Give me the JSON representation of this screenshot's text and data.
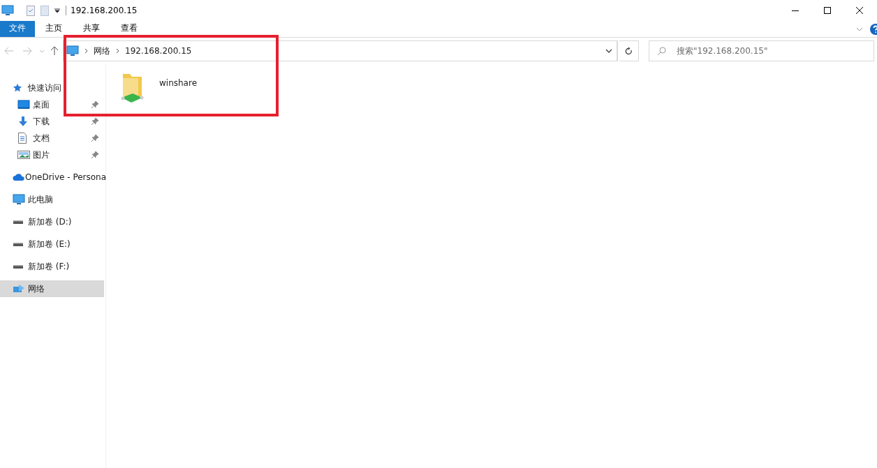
{
  "window": {
    "title": "192.168.200.15"
  },
  "ribbon": {
    "tabs": [
      {
        "label": "文件",
        "kind": "file"
      },
      {
        "label": "主页",
        "kind": "tab"
      },
      {
        "label": "共享",
        "kind": "tab"
      },
      {
        "label": "查看",
        "kind": "tab"
      }
    ]
  },
  "address_bar": {
    "crumbs": [
      "网络",
      "192.168.200.15"
    ]
  },
  "search": {
    "placeholder": "搜索\"192.168.200.15\""
  },
  "sidebar": {
    "items": [
      {
        "label": "快速访问",
        "kind": "star",
        "selected": false,
        "children": [
          {
            "label": "桌面",
            "kind": "desktop",
            "pinned": true,
            "selected": false
          },
          {
            "label": "下载",
            "kind": "download",
            "pinned": true,
            "selected": false
          },
          {
            "label": "文档",
            "kind": "document",
            "pinned": true,
            "selected": false
          },
          {
            "label": "图片",
            "kind": "image",
            "pinned": true,
            "selected": false
          }
        ]
      },
      {
        "label": "OneDrive - Persona",
        "kind": "cloud",
        "selected": false
      },
      {
        "label": "此电脑",
        "kind": "pc",
        "selected": false
      },
      {
        "label": "新加卷 (D:)",
        "kind": "drive",
        "selected": false
      },
      {
        "label": "新加卷 (E:)",
        "kind": "drive",
        "selected": false
      },
      {
        "label": "新加卷 (F:)",
        "kind": "drive",
        "selected": false
      },
      {
        "label": "网络",
        "kind": "network",
        "selected": true
      }
    ]
  },
  "content": {
    "items": [
      {
        "name": "winshare",
        "kind": "share"
      }
    ]
  }
}
